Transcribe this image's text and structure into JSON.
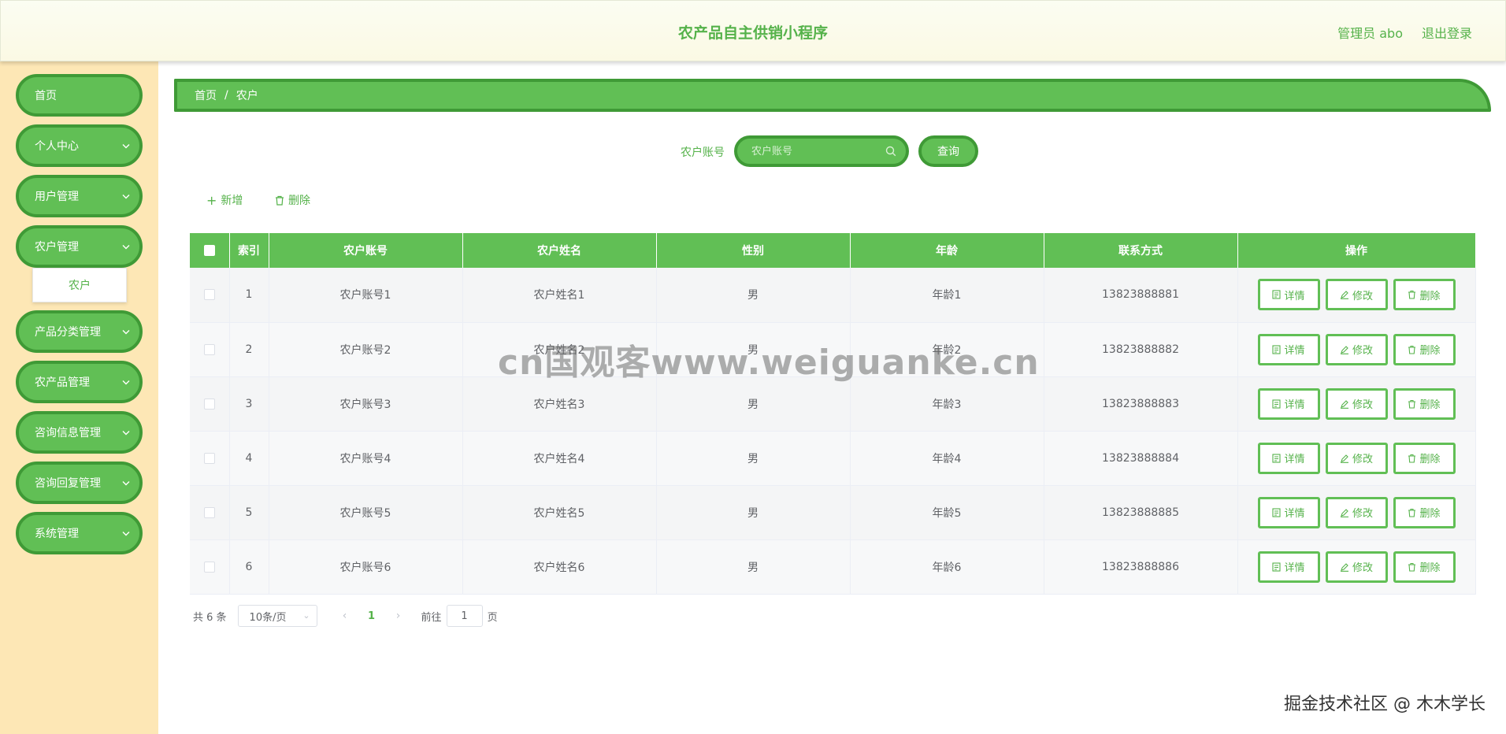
{
  "app": {
    "title": "农产品自主供销小程序",
    "user_label": "管理员 abo",
    "logout_label": "退出登录"
  },
  "sidebar": {
    "items": [
      {
        "label": "首页",
        "has_children": false
      },
      {
        "label": "个人中心",
        "has_children": true
      },
      {
        "label": "用户管理",
        "has_children": true
      },
      {
        "label": "农户管理",
        "has_children": true,
        "expanded": true
      },
      {
        "label": "产品分类管理",
        "has_children": true
      },
      {
        "label": "农产品管理",
        "has_children": true
      },
      {
        "label": "咨询信息管理",
        "has_children": true
      },
      {
        "label": "咨询回复管理",
        "has_children": true
      },
      {
        "label": "系统管理",
        "has_children": true
      }
    ],
    "submenu_item": "农户"
  },
  "breadcrumb": {
    "home": "首页",
    "separator": "/",
    "current": "农户"
  },
  "search": {
    "label": "农户账号",
    "placeholder": "农户账号",
    "value": "",
    "button": "查询"
  },
  "toolbar": {
    "add_label": "新增",
    "delete_label": "删除"
  },
  "table": {
    "columns": [
      "索引",
      "农户账号",
      "农户姓名",
      "性别",
      "年龄",
      "联系方式",
      "操作"
    ],
    "rows": [
      {
        "index": "1",
        "account": "农户账号1",
        "name": "农户姓名1",
        "gender": "男",
        "age": "年龄1",
        "phone": "13823888881"
      },
      {
        "index": "2",
        "account": "农户账号2",
        "name": "农户姓名2",
        "gender": "男",
        "age": "年龄2",
        "phone": "13823888882"
      },
      {
        "index": "3",
        "account": "农户账号3",
        "name": "农户姓名3",
        "gender": "男",
        "age": "年龄3",
        "phone": "13823888883"
      },
      {
        "index": "4",
        "account": "农户账号4",
        "name": "农户姓名4",
        "gender": "男",
        "age": "年龄4",
        "phone": "13823888884"
      },
      {
        "index": "5",
        "account": "农户账号5",
        "name": "农户姓名5",
        "gender": "男",
        "age": "年龄5",
        "phone": "13823888885"
      },
      {
        "index": "6",
        "account": "农户账号6",
        "name": "农户姓名6",
        "gender": "男",
        "age": "年龄6",
        "phone": "13823888886"
      }
    ],
    "actions": {
      "detail": "详情",
      "edit": "修改",
      "delete": "删除"
    }
  },
  "pagination": {
    "total_text": "共 6 条",
    "page_size": "10条/页",
    "current_page": "1",
    "goto_prefix": "前往",
    "goto_value": "1",
    "goto_suffix": "页"
  },
  "watermarks": {
    "center": "cn国观客www.weiguanke.cn",
    "bottom_right": "掘金技术社区 @ 木木学长"
  },
  "colors": {
    "primary": "#61bf55",
    "primary_border": "#3f9a36",
    "accent_text": "#55b24a",
    "sidebar_bg": "#fde7b5",
    "header_bg": "#fbfbec"
  },
  "icons": {
    "chevron": "chevron-down-icon",
    "search": "search-icon",
    "plus": "plus-icon",
    "trash": "trash-icon",
    "document": "document-icon",
    "pencil": "pencil-icon"
  }
}
